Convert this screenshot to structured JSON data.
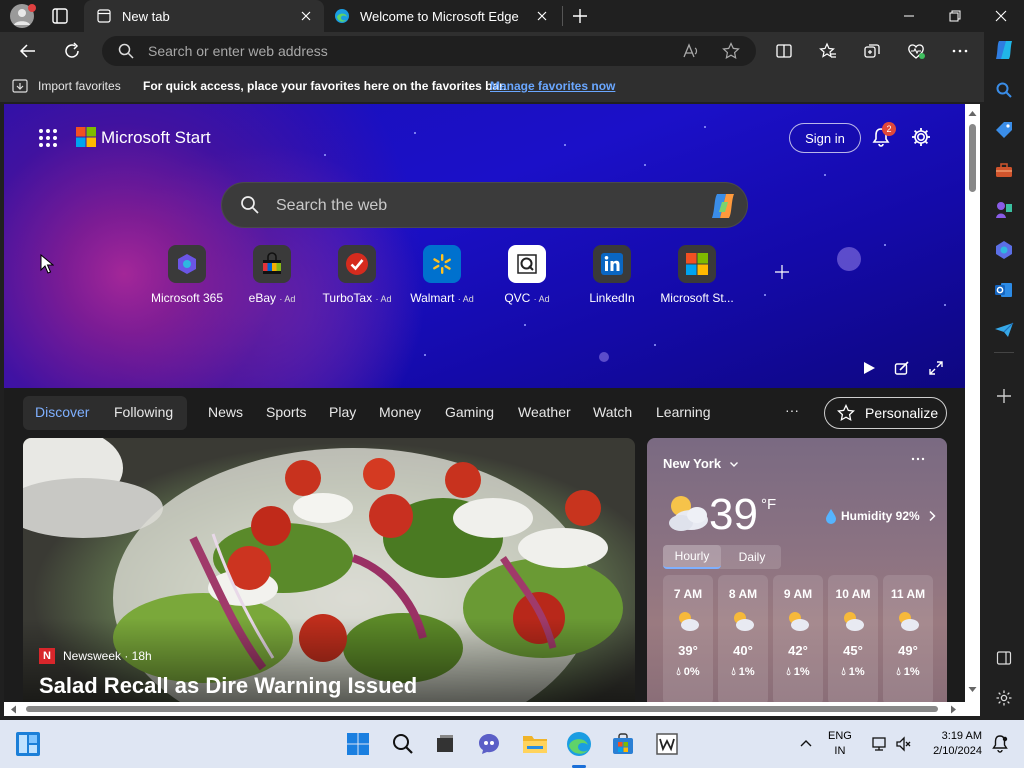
{
  "titlebar": {
    "tabs": [
      {
        "title": "New tab"
      },
      {
        "title": "Welcome to Microsoft Edge"
      }
    ]
  },
  "toolbar": {
    "address_placeholder": "Search or enter web address"
  },
  "favorites_bar": {
    "import_label": "Import favorites",
    "hint": "For quick access, place your favorites here on the favorites bar.",
    "manage_link": "Manage favorites now"
  },
  "hero": {
    "brand": "Microsoft Start",
    "signin": "Sign in",
    "notification_count": "2",
    "search_placeholder": "Search the web",
    "quick_links": [
      {
        "label": "Microsoft 365",
        "ad": ""
      },
      {
        "label": "eBay",
        "ad": "· Ad"
      },
      {
        "label": "TurboTax",
        "ad": "· Ad"
      },
      {
        "label": "Walmart",
        "ad": "· Ad"
      },
      {
        "label": "QVC",
        "ad": "· Ad"
      },
      {
        "label": "LinkedIn",
        "ad": ""
      },
      {
        "label": "Microsoft St...",
        "ad": ""
      }
    ]
  },
  "nav": {
    "tabs": [
      "Discover",
      "Following",
      "News",
      "Sports",
      "Play",
      "Money",
      "Gaming",
      "Weather",
      "Watch",
      "Learning"
    ],
    "more": "···",
    "personalize": "Personalize"
  },
  "news": {
    "source": "Newsweek · 18h",
    "source_badge": "N",
    "headline": "Salad Recall as Dire Warning Issued"
  },
  "weather": {
    "location": "New York",
    "temp": "39",
    "unit": "°F",
    "humidity": "Humidity 92%",
    "tabs": {
      "hourly": "Hourly",
      "daily": "Daily"
    },
    "hours": [
      {
        "time": "7 AM",
        "temp": "39°",
        "rain": "0%"
      },
      {
        "time": "8 AM",
        "temp": "40°",
        "rain": "1%"
      },
      {
        "time": "9 AM",
        "temp": "42°",
        "rain": "1%"
      },
      {
        "time": "10 AM",
        "temp": "45°",
        "rain": "1%"
      },
      {
        "time": "11 AM",
        "temp": "49°",
        "rain": "1%"
      }
    ]
  },
  "taskbar": {
    "lang_line1": "ENG",
    "lang_line2": "IN",
    "time": "3:19 AM",
    "date": "2/10/2024"
  },
  "colors": {
    "accent_link": "#6aa7ff",
    "hero_blue": "#1a0fb8",
    "taskbar": "#dfe6f3"
  }
}
